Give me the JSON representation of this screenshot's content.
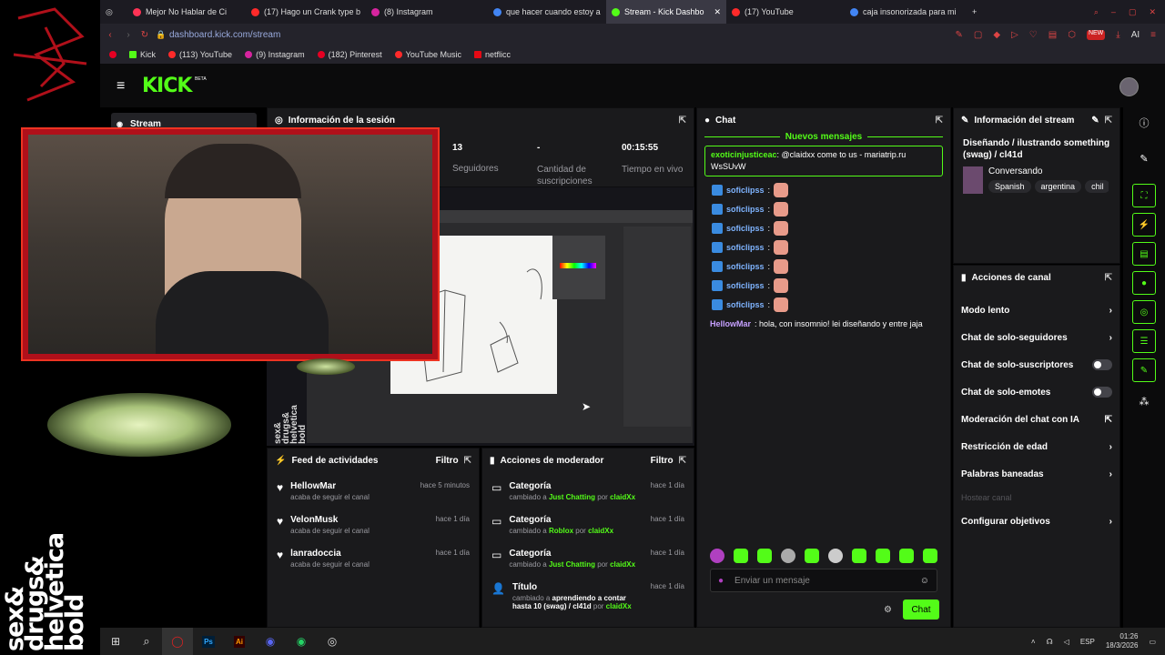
{
  "browser": {
    "tabs": [
      {
        "label": "Mejor No Hablar de Ci",
        "color": "#ff3355"
      },
      {
        "label": "(17) Hago un Crank type b",
        "color": "#ff2a2a"
      },
      {
        "label": "(8) Instagram",
        "color": "#d6249f"
      },
      {
        "label": "que hacer cuando estoy a",
        "color": "#4285f4"
      },
      {
        "label": "Stream - Kick Dashbo",
        "color": "#53fc18"
      },
      {
        "label": "(17) YouTube",
        "color": "#ff2a2a"
      },
      {
        "label": "caja insonorizada para mi",
        "color": "#4285f4"
      }
    ],
    "new_tab": "+",
    "close_tab": "✕",
    "url": "dashboard.kick.com/stream",
    "ai_label": "AI",
    "bookmarks": [
      {
        "label": "Kick",
        "color": "#53fc18"
      },
      {
        "label": "(113) YouTube",
        "color": "#ff2a2a"
      },
      {
        "label": "(9) Instagram",
        "color": "#d6249f"
      },
      {
        "label": "(182) Pinterest",
        "color": "#e60023"
      },
      {
        "label": "YouTube Music",
        "color": "#ff2a2a"
      },
      {
        "label": "netflicc",
        "color": "#e50914"
      }
    ]
  },
  "kick": {
    "logo": "KICK",
    "beta": "BETA",
    "nav_stream": "Stream"
  },
  "session": {
    "title": "Información de la sesión",
    "stats": [
      {
        "value": "13",
        "label": "Seguidores"
      },
      {
        "value": "-",
        "label": "Cantidad de suscripciones"
      },
      {
        "value": "00:15:55",
        "label": "Tiempo en vivo"
      }
    ]
  },
  "activity": {
    "title": "Feed de actividades",
    "filter": "Filtro",
    "items": [
      {
        "name": "HellowMar",
        "sub": "acaba de seguir el canal",
        "time": "hace 5 minutos"
      },
      {
        "name": "VelonMusk",
        "sub": "acaba de seguir el canal",
        "time": "hace 1 día"
      },
      {
        "name": "lanradoccia",
        "sub": "acaba de seguir el canal",
        "time": "hace 1 día"
      }
    ]
  },
  "modactions": {
    "title": "Acciones de moderador",
    "filter": "Filtro",
    "items": [
      {
        "title": "Categoría",
        "pre": "cambiado a ",
        "value": "Just Chatting",
        "by": " por ",
        "user": "claidXx",
        "time": "hace 1 día"
      },
      {
        "title": "Categoría",
        "pre": "cambiado a ",
        "value": "Roblox",
        "by": " por ",
        "user": "claidXx",
        "time": "hace 1 día"
      },
      {
        "title": "Categoría",
        "pre": "cambiado a ",
        "value": "Just Chatting",
        "by": " por ",
        "user": "claidXx",
        "time": "hace 1 día"
      },
      {
        "title": "Título",
        "pre": "cambiado a ",
        "value": "aprendiendo a contar hasta 10 (swag) / cl41d",
        "by": " por ",
        "user": "claidXx",
        "time": "hace 1 día"
      }
    ]
  },
  "chat": {
    "title": "Chat",
    "new_messages": "Nuevos mensajes",
    "highlight_user": "exoticinjusticeac",
    "highlight_text": ": @claidxx come to us - mariatrip.ru WsSUvW",
    "lines": [
      {
        "user": "soficlipss",
        "text": ":"
      },
      {
        "user": "soficlipss",
        "text": ":"
      },
      {
        "user": "soficlipss",
        "text": ":"
      },
      {
        "user": "soficlipss",
        "text": ":"
      },
      {
        "user": "soficlipss",
        "text": ":"
      },
      {
        "user": "soficlipss",
        "text": ":"
      },
      {
        "user": "soficlipss",
        "text": ":"
      }
    ],
    "last_user": "HellowMar",
    "last_text": ": hola, con insomnio! lei diseñando y entre jaja",
    "input_placeholder": "Enviar un mensaje",
    "send": "Chat"
  },
  "streaminfo": {
    "title": "Información del stream",
    "stream_title": "Diseñando / ilustrando something (swag) / cl41d",
    "category": "Conversando",
    "tags": [
      "Spanish",
      "argentina",
      "chil"
    ]
  },
  "channel": {
    "title": "Acciones de canal",
    "rows": [
      {
        "label": "Modo lento",
        "ctrl": "chevron"
      },
      {
        "label": "Chat de solo-seguidores",
        "ctrl": "chevron"
      },
      {
        "label": "Chat de solo-suscriptores",
        "ctrl": "toggle"
      },
      {
        "label": "Chat de solo-emotes",
        "ctrl": "toggle"
      },
      {
        "label": "Moderación del chat con IA",
        "ctrl": "external"
      },
      {
        "label": "Restricción de edad",
        "ctrl": "chevron"
      },
      {
        "label": "Palabras baneadas",
        "ctrl": "chevron"
      },
      {
        "label": "Hostear canal",
        "ctrl": "none"
      },
      {
        "label": "Configurar objetivos",
        "ctrl": "chevron"
      }
    ]
  },
  "overlay": {
    "side_text": "sex& drugs& helvetica bold",
    "preview_text": "sex& drugs& helvetica bold"
  },
  "taskbar": {
    "lang": "ESP",
    "time": "01:26",
    "date": "18/3/2026"
  },
  "colors": {
    "accent": "#53fc18",
    "panel": "#1a1a1c",
    "frame": "#c0101a"
  }
}
